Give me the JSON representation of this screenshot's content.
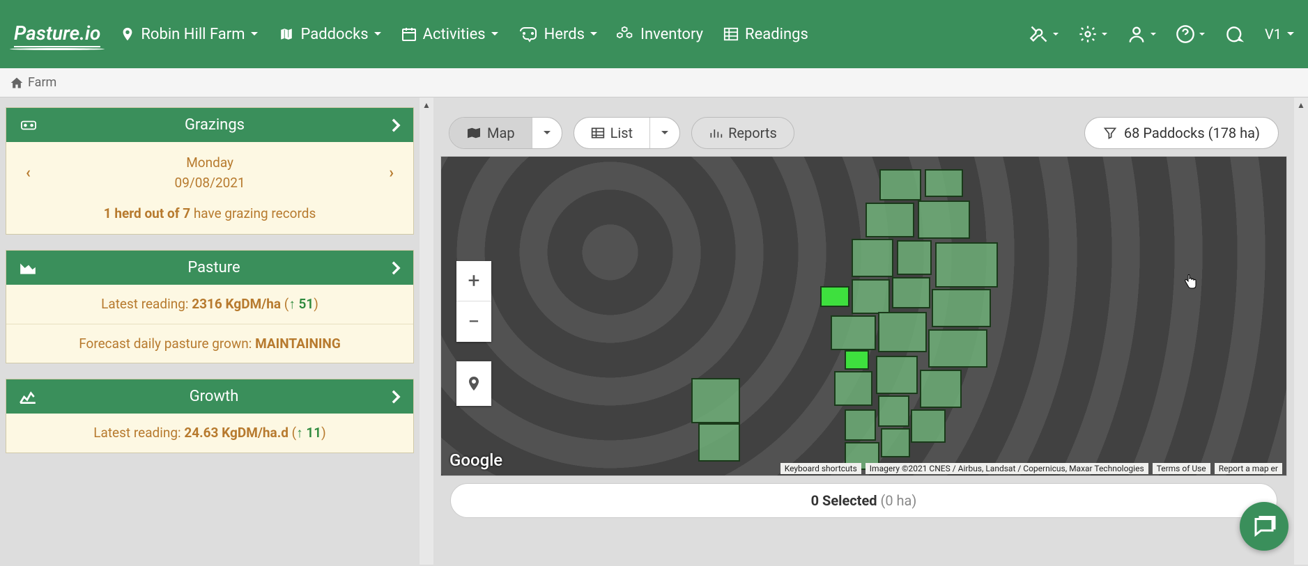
{
  "brand": "Pasture.io",
  "nav": {
    "farm": "Robin Hill Farm",
    "paddocks": "Paddocks",
    "activities": "Activities",
    "herds": "Herds",
    "inventory": "Inventory",
    "readings": "Readings",
    "version": "V1"
  },
  "breadcrumb": {
    "home": "Farm"
  },
  "grazings": {
    "title": "Grazings",
    "day": "Monday",
    "date": "09/08/2021",
    "status_prefix": "1 herd out of 7",
    "status_suffix": " have grazing records"
  },
  "pasture": {
    "title": "Pasture",
    "latest_label": "Latest reading: ",
    "latest_value": "2316 KgDM/ha",
    "delta": "51",
    "forecast_label": "Forecast daily pasture grown: ",
    "forecast_value": "MAINTAINING"
  },
  "growth": {
    "title": "Growth",
    "latest_label": "Latest reading: ",
    "latest_value": "24.63 KgDM/ha.d",
    "delta": "11"
  },
  "mapControls": {
    "map": "Map",
    "list": "List",
    "reports": "Reports",
    "filter": "68 Paddocks (178 ha)"
  },
  "map": {
    "google": "Google",
    "attrib_shortcuts": "Keyboard shortcuts",
    "attrib_imagery": "Imagery ©2021 CNES / Airbus, Landsat / Copernicus, Maxar Technologies",
    "attrib_terms": "Terms of Use",
    "attrib_report": "Report a map er"
  },
  "selection": {
    "count_label": "0 Selected ",
    "area": "(0 ha)"
  }
}
